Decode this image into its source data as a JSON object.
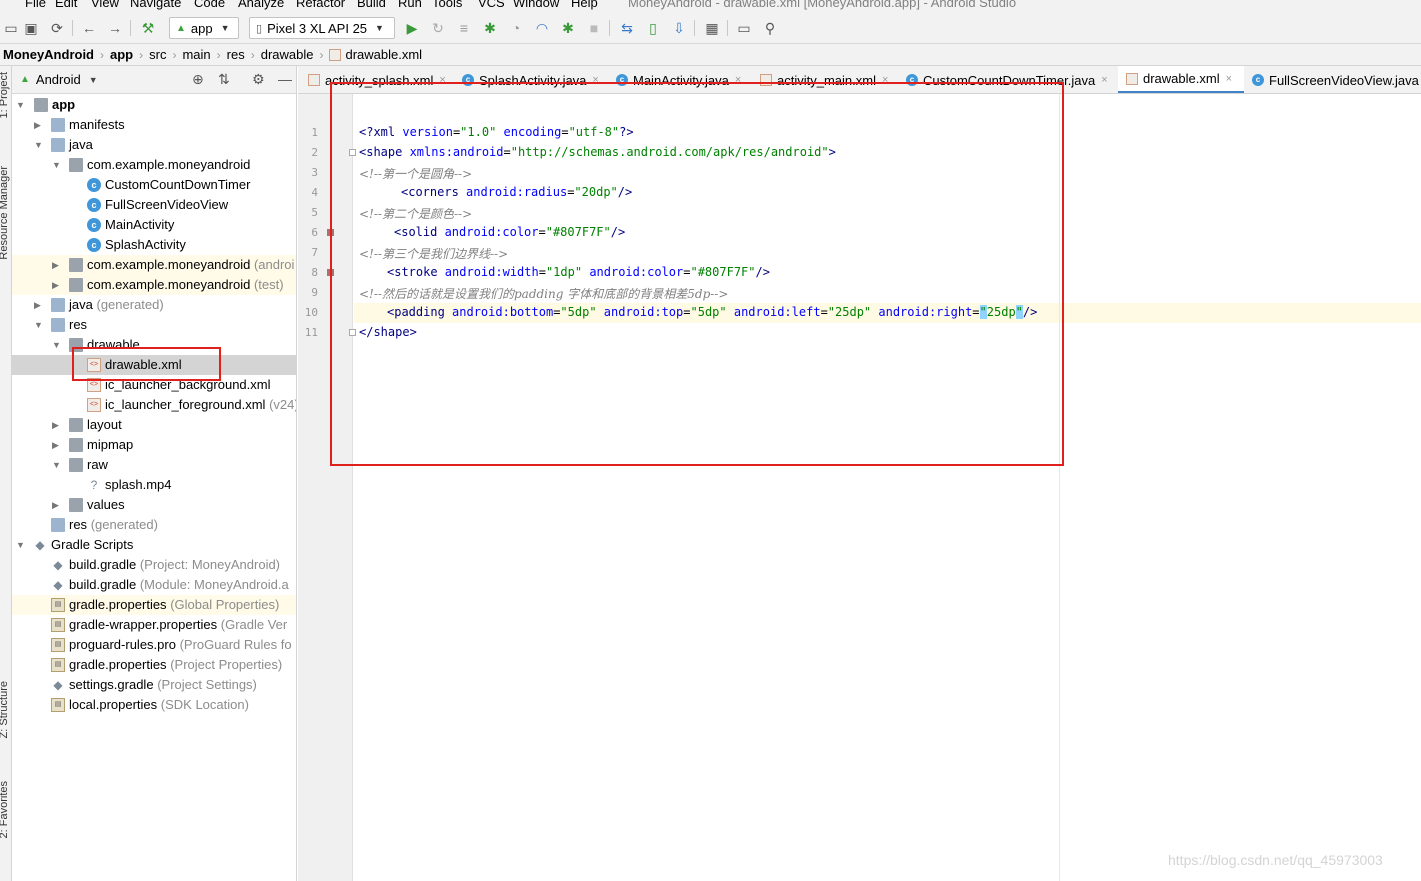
{
  "menu": {
    "items": [
      "File",
      "Edit",
      "View",
      "Navigate",
      "Code",
      "Analyze",
      "Refactor",
      "Build",
      "Run",
      "Tools",
      "VCS",
      "Window",
      "Help"
    ],
    "window_title": "MoneyAndroid - drawable.xml [MoneyAndroid.app] - Android Studio"
  },
  "toolbar": {
    "config": "app",
    "device": "Pixel 3 XL API 25"
  },
  "breadcrumb": [
    "MoneyAndroid",
    "app",
    "src",
    "main",
    "res",
    "drawable",
    "drawable.xml"
  ],
  "side_tabs": {
    "project": "1: Project",
    "resource_manager": "Resource Manager",
    "structure": "Z: Structure",
    "favorites": "2: Favorites"
  },
  "project_panel": {
    "view_mode": "Android"
  },
  "tree": [
    {
      "label": "app",
      "bold": true
    },
    {
      "label": "manifests"
    },
    {
      "label": "java"
    },
    {
      "label": "com.example.moneyandroid"
    },
    {
      "label": "CustomCountDownTimer"
    },
    {
      "label": "FullScreenVideoView"
    },
    {
      "label": "MainActivity"
    },
    {
      "label": "SplashActivity"
    },
    {
      "label": "com.example.moneyandroid",
      "suffix": "(androi"
    },
    {
      "label": "com.example.moneyandroid",
      "suffix": "(test)"
    },
    {
      "label": "java",
      "suffix": "(generated)"
    },
    {
      "label": "res"
    },
    {
      "label": "drawable"
    },
    {
      "label": "drawable.xml"
    },
    {
      "label": "ic_launcher_background.xml"
    },
    {
      "label": "ic_launcher_foreground.xml",
      "suffix": "(v24)"
    },
    {
      "label": "layout"
    },
    {
      "label": "mipmap"
    },
    {
      "label": "raw"
    },
    {
      "label": "splash.mp4"
    },
    {
      "label": "values"
    },
    {
      "label": "res",
      "suffix": "(generated)"
    },
    {
      "label": "Gradle Scripts"
    },
    {
      "label": "build.gradle",
      "suffix": "(Project: MoneyAndroid)"
    },
    {
      "label": "build.gradle",
      "suffix": "(Module: MoneyAndroid.a"
    },
    {
      "label": "gradle.properties",
      "suffix": "(Global Properties)"
    },
    {
      "label": "gradle-wrapper.properties",
      "suffix": "(Gradle Ver"
    },
    {
      "label": "proguard-rules.pro",
      "suffix": "(ProGuard Rules fo"
    },
    {
      "label": "gradle.properties",
      "suffix": "(Project Properties)"
    },
    {
      "label": "settings.gradle",
      "suffix": "(Project Settings)"
    },
    {
      "label": "local.properties",
      "suffix": "(SDK Location)"
    }
  ],
  "tabs": [
    {
      "label": "activity_splash.xml",
      "kind": "xml"
    },
    {
      "label": "SplashActivity.java",
      "kind": "class"
    },
    {
      "label": "MainActivity.java",
      "kind": "class"
    },
    {
      "label": "activity_main.xml",
      "kind": "xml"
    },
    {
      "label": "CustomCountDownTimer.java",
      "kind": "class"
    },
    {
      "label": "drawable.xml",
      "kind": "xml",
      "active": true
    },
    {
      "label": "FullScreenVideoView.java",
      "kind": "class"
    }
  ],
  "tab_close": "×",
  "editor": {
    "line_numbers": [
      "1",
      "2",
      "3",
      "4",
      "5",
      "6",
      "7",
      "8",
      "9",
      "10",
      "11"
    ],
    "lines": {
      "l1": {
        "p1": "<?",
        "t1": "xml ",
        "a1": "version",
        "e1": "=",
        "v1": "\"1.0\" ",
        "a2": "encoding",
        "e2": "=",
        "v2": "\"utf-8\"",
        "p2": "?>"
      },
      "l2": {
        "t1": "<shape ",
        "a1": "xmlns:android",
        "e1": "=",
        "v1": "\"http://schemas.android.com/apk/res/android\"",
        "t2": ">"
      },
      "l3": {
        "c": "<!--第一个是圆角-->"
      },
      "l4": {
        "t1": "<corners ",
        "a1": "android:radius",
        "e1": "=",
        "v1": "\"20dp\"",
        "t2": "/>"
      },
      "l5": {
        "c": "<!--第二个是颜色-->"
      },
      "l6": {
        "t1": "<solid ",
        "a1": "android:color",
        "e1": "=",
        "v1": "\"#807F7F\"",
        "t2": "/>"
      },
      "l7": {
        "c": "<!--第三个是我们边界线-->"
      },
      "l8": {
        "t1": "<stroke ",
        "a1": "android:width",
        "e1": "=",
        "v1": "\"1dp\" ",
        "a2": "android:color",
        "e2": "=",
        "v2": "\"#807F7F\"",
        "t2": "/>"
      },
      "l9": {
        "c": "<!--然后的话就是设置我们的padding 字体和底部的背景相差5dp-->"
      },
      "l10": {
        "t1": "<padding ",
        "a1": "android:bottom",
        "e1": "=",
        "v1": "\"5dp\" ",
        "a2": "android:top",
        "e2": "=",
        "v2": "\"5dp\" ",
        "a3": "android:left",
        "e3": "=",
        "v3": "\"25dp\" ",
        "a4": "android:right",
        "e4": "=",
        "q1": "\"",
        "v4": "25dp",
        "q2": "\"",
        "t2": "/>"
      },
      "l11": {
        "t1": "</shape>"
      }
    }
  },
  "watermark": "https://blog.csdn.net/qq_45973003",
  "colors": {
    "annotation_box": "#e0201c",
    "active_tab_underline": "#4083c9",
    "current_line": "#fffae3"
  }
}
